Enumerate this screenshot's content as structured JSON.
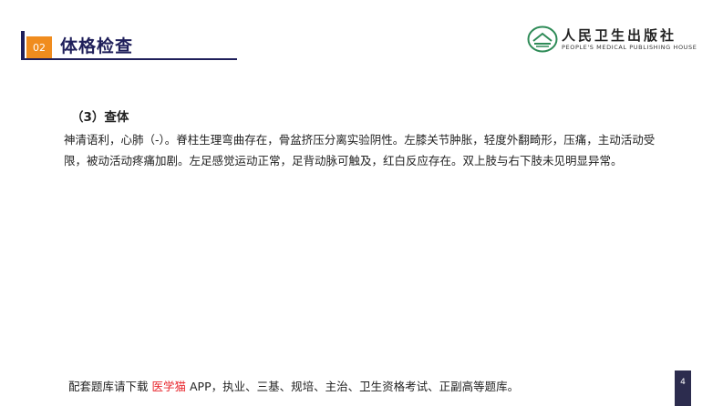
{
  "header": {
    "section_number": "02",
    "title": "体格检查"
  },
  "logo": {
    "emblem_icon": "publisher-emblem-icon",
    "name_cn": "人民卫生出版社",
    "name_en": "PEOPLE'S MEDICAL PUBLISHING HOUSE"
  },
  "content": {
    "subheading": "（3）查体",
    "paragraph": "神清语利，心肺（-）。脊柱生理弯曲存在，骨盆挤压分离实验阴性。左膝关节肿胀，轻度外翻畸形，压痛，主动活动受限，被动活动疼痛加剧。左足感觉运动正常，足背动脉可触及，红白反应存在。双上肢与右下肢未见明显异常。"
  },
  "footer": {
    "prefix": "配套题库请下载",
    "brand": "医学猫",
    "suffix": "APP，执业、三基、规培、主治、卫生资格考试、正副高等题库。"
  },
  "page_number": "4",
  "colors": {
    "accent_navy": "#1f1f5a",
    "badge_orange": "#f08c1e",
    "brand_red": "#e8272d",
    "logo_green": "#2e8b57"
  }
}
